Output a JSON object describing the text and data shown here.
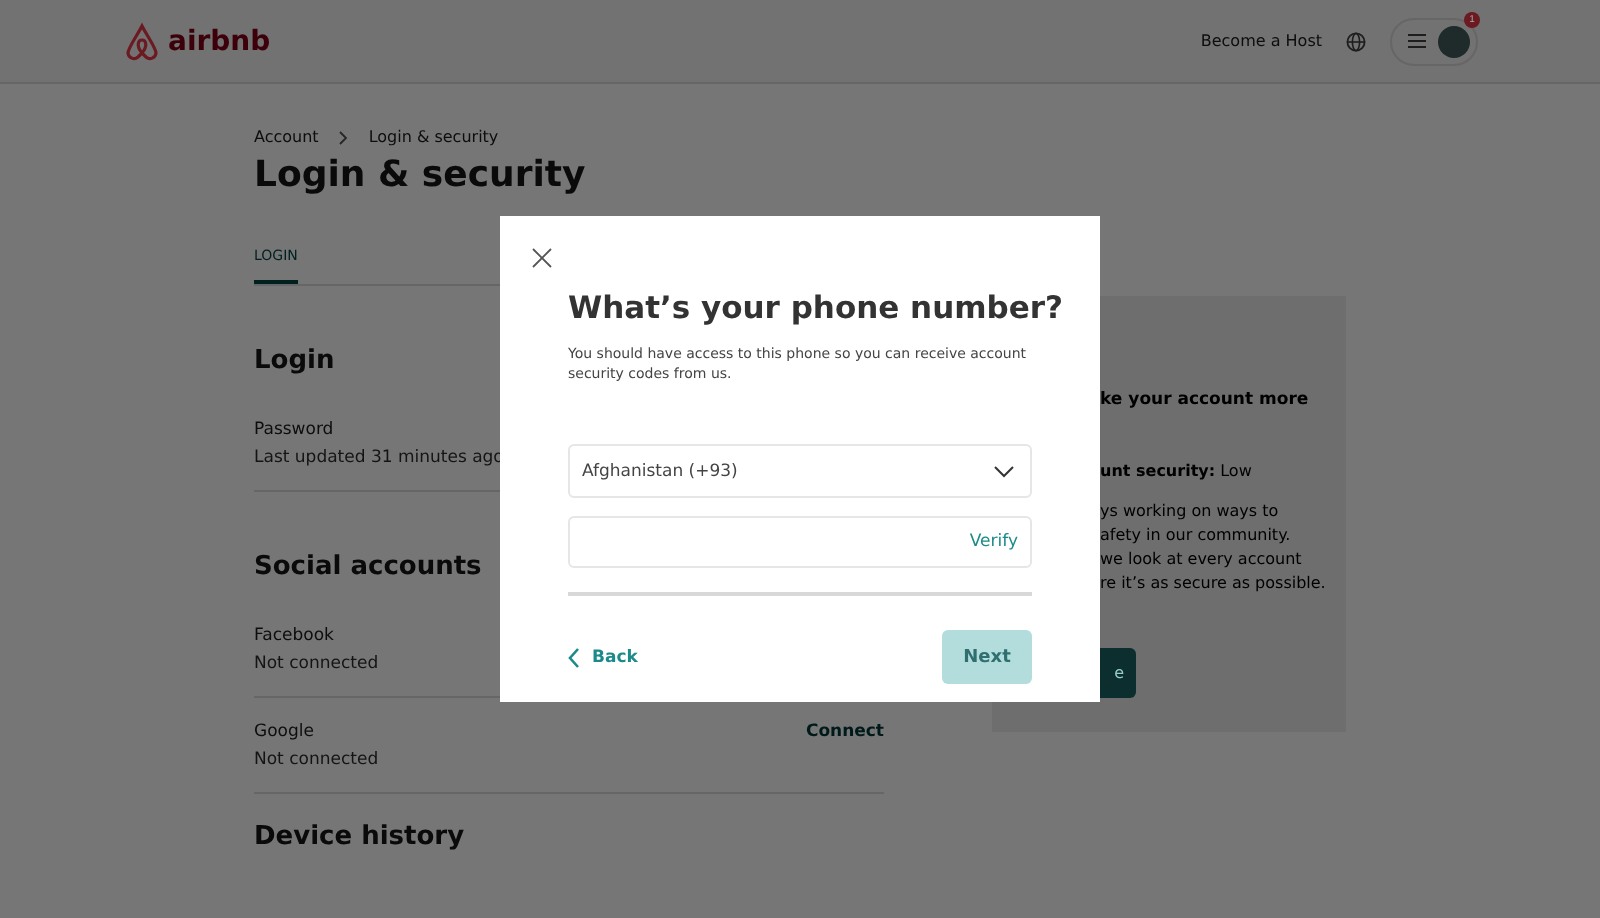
{
  "header": {
    "logo": "airbnb",
    "host_link": "Become a Host",
    "notification_badge": "1"
  },
  "breadcrumb": [
    "Account",
    "Login & security"
  ],
  "page_title": "Login & security",
  "tabs": [
    {
      "label": "LOGIN",
      "selected": true
    }
  ],
  "sections": [
    {
      "heading": "Login",
      "rows": [
        {
          "label": "Password",
          "detail": "Last updated 31 minutes ago"
        }
      ]
    },
    {
      "heading": "Social accounts",
      "rows": [
        {
          "label": "Facebook",
          "detail": "Not connected"
        },
        {
          "label": "Google",
          "detail": "Not connected",
          "action": "Connect"
        }
      ]
    },
    {
      "heading": "Device history"
    }
  ],
  "side_card": {
    "lines": [
      {
        "kind": "heading",
        "text": "ke your account more"
      },
      {
        "kind": "status",
        "text": "unt security:",
        "value": "Low"
      },
      {
        "kind": "body",
        "text": "ys working on ways to"
      },
      {
        "kind": "body",
        "text": "afety in our community."
      },
      {
        "kind": "body",
        "text": "we look at every account"
      },
      {
        "kind": "body",
        "text": "re it’s as secure as possible."
      }
    ],
    "button_text": "e"
  },
  "modal": {
    "title": "What’s your phone number?",
    "description": "You should have access to this phone so you can receive account security codes from us.",
    "country_select": "Afghanistan (+93)",
    "verify_label": "Verify",
    "back_label": "Back",
    "next_label": "Next",
    "next_disabled": true
  }
}
